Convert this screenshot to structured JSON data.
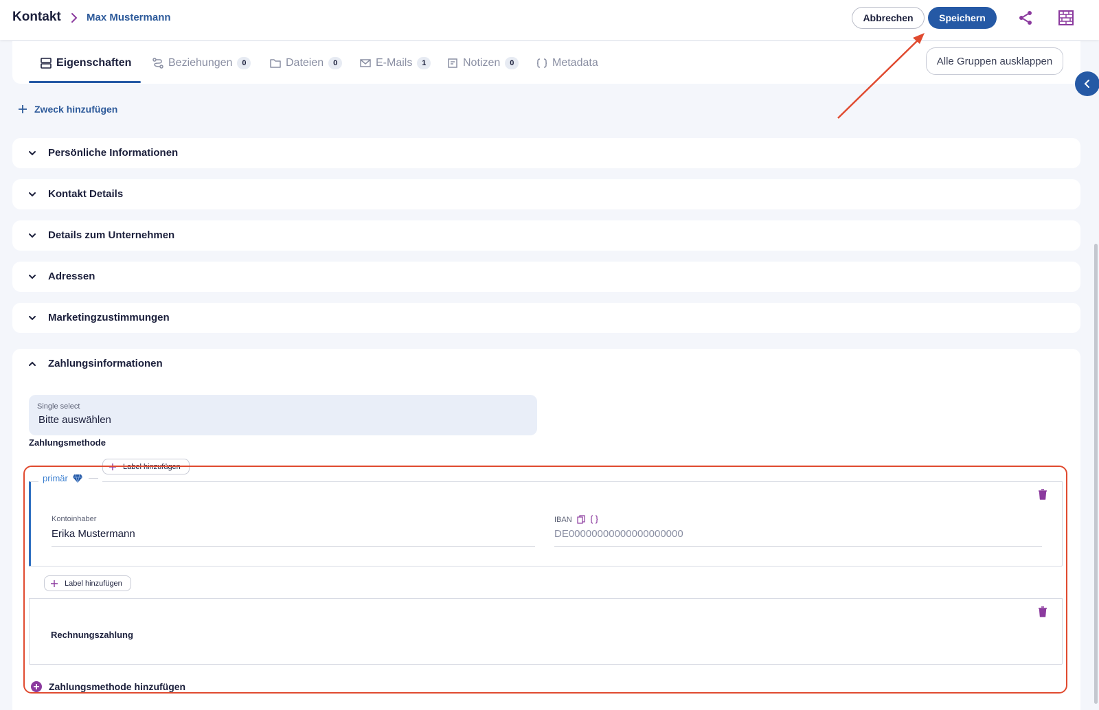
{
  "header": {
    "breadcrumb_root": "Kontakt",
    "breadcrumb_current": "Max Mustermann",
    "cancel_label": "Abbrechen",
    "save_label": "Speichern"
  },
  "tabs": [
    {
      "label": "Eigenschaften",
      "icon": "properties-icon",
      "active": true
    },
    {
      "label": "Beziehungen",
      "icon": "relations-icon",
      "badge": "0"
    },
    {
      "label": "Dateien",
      "icon": "folder-icon",
      "badge": "0"
    },
    {
      "label": "E-Mails",
      "icon": "mail-icon",
      "badge": "1"
    },
    {
      "label": "Notizen",
      "icon": "notes-icon",
      "badge": "0"
    },
    {
      "label": "Metadata",
      "icon": "braces-icon"
    }
  ],
  "expand_all_label": "Alle Gruppen ausklappen",
  "add_purpose_label": "Zweck hinzufügen",
  "sections": [
    {
      "label": "Persönliche Informationen"
    },
    {
      "label": "Kontakt Details"
    },
    {
      "label": "Details zum Unternehmen"
    },
    {
      "label": "Adressen"
    },
    {
      "label": "Marketingzustimmungen"
    }
  ],
  "payment": {
    "title": "Zahlungsinformationen",
    "select_caption": "Single select",
    "select_value": "Bitte auswählen",
    "field_label": "Zahlungsmethode",
    "primary_label": "primär",
    "label_add": "Label hinzufügen",
    "account_holder_caption": "Kontoinhaber",
    "account_holder_value": "Erika Mustermann",
    "iban_caption": "IBAN",
    "iban_placeholder": "DE00000000000000000000",
    "invoice_label": "Rechnungszahlung",
    "add_method_label": "Zahlungsmethode hinzufügen"
  },
  "colors": {
    "accent": "#2559a5",
    "link": "#2d5a9a",
    "icon_purple": "#8b3a9e",
    "annotation": "#e04a2f"
  }
}
